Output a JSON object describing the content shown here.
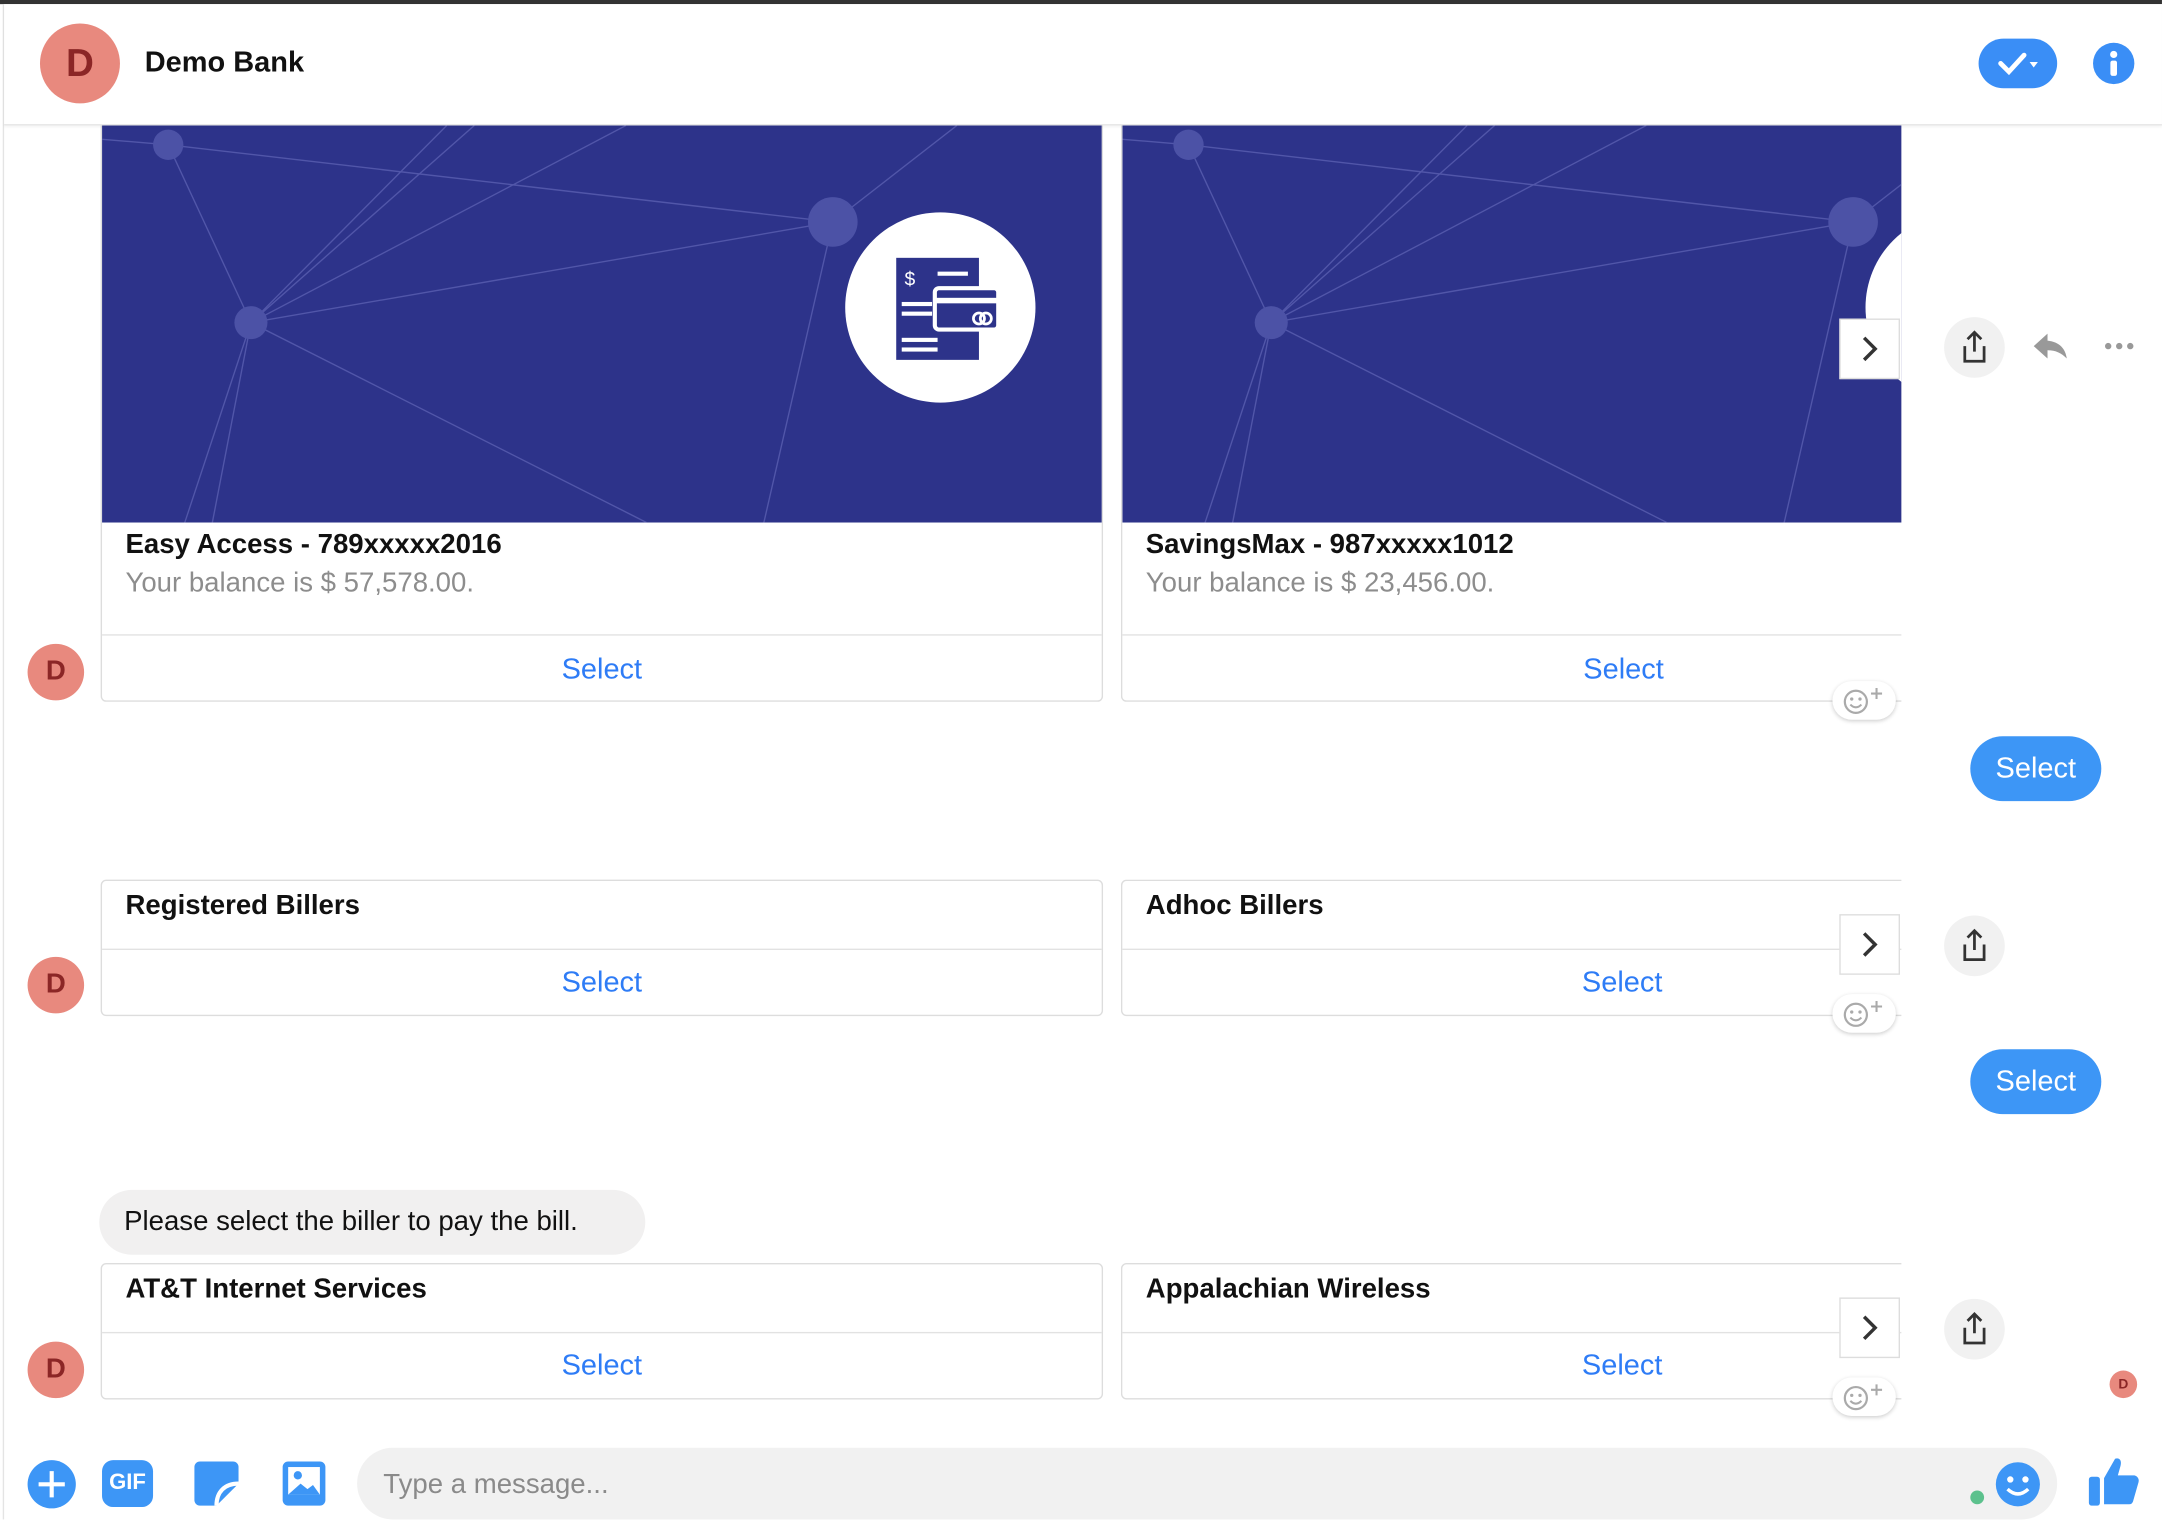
{
  "header": {
    "avatar_letter": "D",
    "title": "Demo Bank",
    "status_icon": "check-dropdown-icon",
    "info_icon": "info-icon"
  },
  "colors": {
    "accent": "#3d96f6",
    "avatar": "#e8897e",
    "card_image": "#2d338a",
    "link": "#2e7cf6"
  },
  "messages": {
    "accounts": [
      {
        "title": "Easy Access - 789xxxxx2016",
        "balance": "Your balance is $ 57,578.00.",
        "button": "Select"
      },
      {
        "title": "SavingsMax - 987xxxxx1012",
        "balance": "Your balance is $ 23,456.00.",
        "button": "Select"
      }
    ],
    "reply1": "Select",
    "billers_types": [
      {
        "title": "Registered Billers",
        "button": "Select"
      },
      {
        "title": "Adhoc Billers",
        "button": "Select"
      }
    ],
    "reply2": "Select",
    "prompt": "Please select the biller to pay the bill.",
    "billers": [
      {
        "title": "AT&T Internet Services",
        "button": "Select"
      },
      {
        "title": "Appalachian Wireless",
        "button": "Select"
      }
    ],
    "avatar_letter": "D"
  },
  "composer": {
    "placeholder": "Type a message...",
    "gif_label": "GIF"
  }
}
